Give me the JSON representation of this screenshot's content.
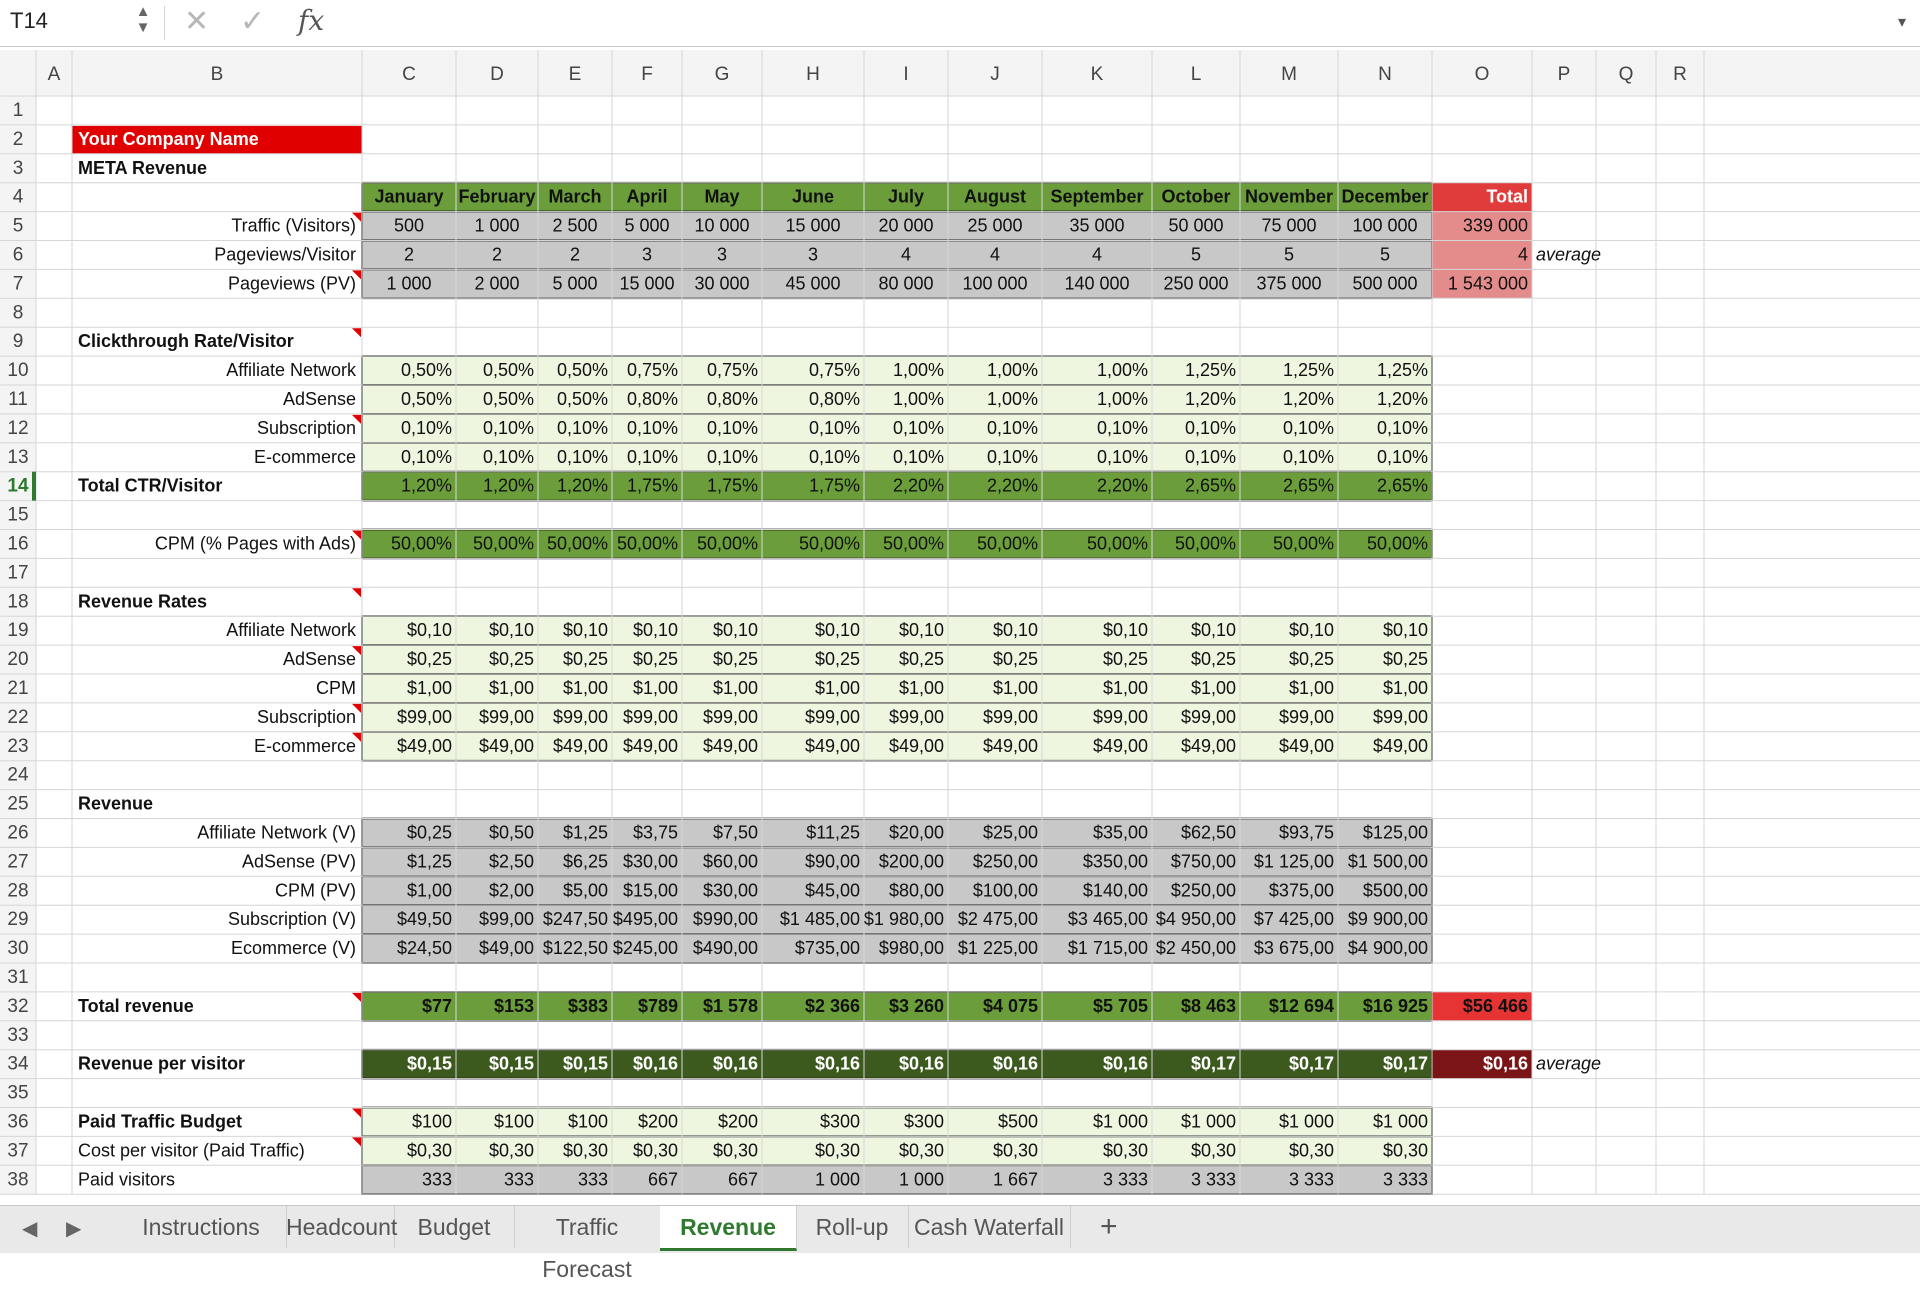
{
  "formula_bar": {
    "cell_ref": "T14",
    "stepper_up": "▲",
    "stepper_down": "▼",
    "cancel_glyph": "✕",
    "confirm_glyph": "✓",
    "fx_label": "fx",
    "formula": "",
    "expand_glyph": "▾"
  },
  "columns": [
    "A",
    "B",
    "C",
    "D",
    "E",
    "F",
    "G",
    "H",
    "I",
    "J",
    "K",
    "L",
    "M",
    "N",
    "O",
    "P",
    "Q",
    "R"
  ],
  "active_row": 14,
  "colors": {
    "green": "#6b9e3a",
    "dark_green": "#3d5a1e",
    "light_green": "#eef6e0",
    "gray": "#c8c8c8",
    "red_header": "#e03c3c",
    "pink_total": "#e48c8c",
    "red_total": "#e63434",
    "dark_red": "#7a1416",
    "company_red": "#e00000",
    "active_accent": "#2f7a2f"
  },
  "rows": [
    {
      "n": 1,
      "gap": true
    },
    {
      "n": 2,
      "b": "Your Company Name",
      "b_style": "company"
    },
    {
      "n": 3,
      "b": "META Revenue",
      "b_bold": true
    },
    {
      "n": 4,
      "fill": "green",
      "bold": true,
      "center": true,
      "vals": [
        "January",
        "February",
        "March",
        "April",
        "May",
        "June",
        "July",
        "August",
        "September",
        "October",
        "November",
        "December"
      ],
      "o": "Total",
      "o_fill": "red_header",
      "o_color": "#fff"
    },
    {
      "n": 5,
      "b": "Traffic (Visitors)",
      "b_right": true,
      "b_note": true,
      "fill": "gray",
      "center": true,
      "vals": [
        "500",
        "1 000",
        "2 500",
        "5 000",
        "10 000",
        "15 000",
        "20 000",
        "25 000",
        "35 000",
        "50 000",
        "75 000",
        "100 000"
      ],
      "o": "339 000",
      "o_fill": "pink_total"
    },
    {
      "n": 6,
      "b": "Pageviews/Visitor",
      "b_right": true,
      "fill": "gray",
      "center": true,
      "vals": [
        "2",
        "2",
        "2",
        "3",
        "3",
        "3",
        "4",
        "4",
        "4",
        "5",
        "5",
        "5"
      ],
      "o": "4",
      "o_fill": "pink_total",
      "p": "average"
    },
    {
      "n": 7,
      "b": "Pageviews (PV)",
      "b_right": true,
      "b_note": true,
      "fill": "gray",
      "center": true,
      "vals": [
        "1 000",
        "2 000",
        "5 000",
        "15 000",
        "30 000",
        "45 000",
        "80 000",
        "100 000",
        "140 000",
        "250 000",
        "375 000",
        "500 000"
      ],
      "o": "1 543 000",
      "o_fill": "pink_total"
    },
    {
      "n": 8,
      "gap": true
    },
    {
      "n": 9,
      "b": "Clickthrough Rate/Visitor",
      "b_bold": true,
      "b_note": true
    },
    {
      "n": 10,
      "b": "Affiliate Network",
      "b_right": true,
      "fill": "light_green",
      "vals": [
        "0,50%",
        "0,50%",
        "0,50%",
        "0,75%",
        "0,75%",
        "0,75%",
        "1,00%",
        "1,00%",
        "1,00%",
        "1,25%",
        "1,25%",
        "1,25%"
      ]
    },
    {
      "n": 11,
      "b": "AdSense",
      "b_right": true,
      "fill": "light_green",
      "vals": [
        "0,50%",
        "0,50%",
        "0,50%",
        "0,80%",
        "0,80%",
        "0,80%",
        "1,00%",
        "1,00%",
        "1,00%",
        "1,20%",
        "1,20%",
        "1,20%"
      ]
    },
    {
      "n": 12,
      "b": "Subscription",
      "b_right": true,
      "b_note": true,
      "fill": "light_green",
      "vals": [
        "0,10%",
        "0,10%",
        "0,10%",
        "0,10%",
        "0,10%",
        "0,10%",
        "0,10%",
        "0,10%",
        "0,10%",
        "0,10%",
        "0,10%",
        "0,10%"
      ]
    },
    {
      "n": 13,
      "b": "E-commerce",
      "b_right": true,
      "fill": "light_green",
      "vals": [
        "0,10%",
        "0,10%",
        "0,10%",
        "0,10%",
        "0,10%",
        "0,10%",
        "0,10%",
        "0,10%",
        "0,10%",
        "0,10%",
        "0,10%",
        "0,10%"
      ]
    },
    {
      "n": 14,
      "b": "Total CTR/Visitor",
      "b_bold": true,
      "fill": "green",
      "vals": [
        "1,20%",
        "1,20%",
        "1,20%",
        "1,75%",
        "1,75%",
        "1,75%",
        "2,20%",
        "2,20%",
        "2,20%",
        "2,65%",
        "2,65%",
        "2,65%"
      ]
    },
    {
      "n": 15,
      "gap": true
    },
    {
      "n": 16,
      "b": "CPM (% Pages with Ads)",
      "b_right": true,
      "b_note": true,
      "fill": "green",
      "vals": [
        "50,00%",
        "50,00%",
        "50,00%",
        "50,00%",
        "50,00%",
        "50,00%",
        "50,00%",
        "50,00%",
        "50,00%",
        "50,00%",
        "50,00%",
        "50,00%"
      ]
    },
    {
      "n": 17,
      "gap": true
    },
    {
      "n": 18,
      "b": "Revenue Rates",
      "b_bold": true,
      "b_note": true
    },
    {
      "n": 19,
      "b": "Affiliate Network",
      "b_right": true,
      "fill": "light_green",
      "vals": [
        "$0,10",
        "$0,10",
        "$0,10",
        "$0,10",
        "$0,10",
        "$0,10",
        "$0,10",
        "$0,10",
        "$0,10",
        "$0,10",
        "$0,10",
        "$0,10"
      ]
    },
    {
      "n": 20,
      "b": "AdSense",
      "b_right": true,
      "b_note": true,
      "fill": "light_green",
      "vals": [
        "$0,25",
        "$0,25",
        "$0,25",
        "$0,25",
        "$0,25",
        "$0,25",
        "$0,25",
        "$0,25",
        "$0,25",
        "$0,25",
        "$0,25",
        "$0,25"
      ]
    },
    {
      "n": 21,
      "b": "CPM",
      "b_right": true,
      "fill": "light_green",
      "vals": [
        "$1,00",
        "$1,00",
        "$1,00",
        "$1,00",
        "$1,00",
        "$1,00",
        "$1,00",
        "$1,00",
        "$1,00",
        "$1,00",
        "$1,00",
        "$1,00"
      ]
    },
    {
      "n": 22,
      "b": "Subscription",
      "b_right": true,
      "b_note": true,
      "fill": "light_green",
      "vals": [
        "$99,00",
        "$99,00",
        "$99,00",
        "$99,00",
        "$99,00",
        "$99,00",
        "$99,00",
        "$99,00",
        "$99,00",
        "$99,00",
        "$99,00",
        "$99,00"
      ]
    },
    {
      "n": 23,
      "b": "E-commerce",
      "b_right": true,
      "b_note": true,
      "fill": "light_green",
      "vals": [
        "$49,00",
        "$49,00",
        "$49,00",
        "$49,00",
        "$49,00",
        "$49,00",
        "$49,00",
        "$49,00",
        "$49,00",
        "$49,00",
        "$49,00",
        "$49,00"
      ]
    },
    {
      "n": 24,
      "gap": true
    },
    {
      "n": 25,
      "b": "Revenue",
      "b_bold": true
    },
    {
      "n": 26,
      "b": "Affiliate Network (V)",
      "b_right": true,
      "fill": "gray",
      "vals": [
        "$0,25",
        "$0,50",
        "$1,25",
        "$3,75",
        "$7,50",
        "$11,25",
        "$20,00",
        "$25,00",
        "$35,00",
        "$62,50",
        "$93,75",
        "$125,00"
      ]
    },
    {
      "n": 27,
      "b": "AdSense (PV)",
      "b_right": true,
      "fill": "gray",
      "vals": [
        "$1,25",
        "$2,50",
        "$6,25",
        "$30,00",
        "$60,00",
        "$90,00",
        "$200,00",
        "$250,00",
        "$350,00",
        "$750,00",
        "$1 125,00",
        "$1 500,00"
      ]
    },
    {
      "n": 28,
      "b": "CPM (PV)",
      "b_right": true,
      "fill": "gray",
      "vals": [
        "$1,00",
        "$2,00",
        "$5,00",
        "$15,00",
        "$30,00",
        "$45,00",
        "$80,00",
        "$100,00",
        "$140,00",
        "$250,00",
        "$375,00",
        "$500,00"
      ]
    },
    {
      "n": 29,
      "b": "Subscription (V)",
      "b_right": true,
      "fill": "gray",
      "vals": [
        "$49,50",
        "$99,00",
        "$247,50",
        "$495,00",
        "$990,00",
        "$1 485,00",
        "$1 980,00",
        "$2 475,00",
        "$3 465,00",
        "$4 950,00",
        "$7 425,00",
        "$9 900,00"
      ]
    },
    {
      "n": 30,
      "b": "Ecommerce (V)",
      "b_right": true,
      "fill": "gray",
      "vals": [
        "$24,50",
        "$49,00",
        "$122,50",
        "$245,00",
        "$490,00",
        "$735,00",
        "$980,00",
        "$1 225,00",
        "$1 715,00",
        "$2 450,00",
        "$3 675,00",
        "$4 900,00"
      ]
    },
    {
      "n": 31,
      "gap": true
    },
    {
      "n": 32,
      "b": "Total revenue",
      "b_bold": true,
      "b_note": true,
      "fill": "green",
      "bold": true,
      "vals": [
        "$77",
        "$153",
        "$383",
        "$789",
        "$1 578",
        "$2 366",
        "$3 260",
        "$4 075",
        "$5 705",
        "$8 463",
        "$12 694",
        "$16 925"
      ],
      "o": "$56 466",
      "o_fill": "red_total",
      "o_bold": true
    },
    {
      "n": 33,
      "gap": true
    },
    {
      "n": 34,
      "b": "Revenue per visitor",
      "b_bold": true,
      "fill": "dark_green",
      "bold": true,
      "color": "#fff",
      "vals": [
        "$0,15",
        "$0,15",
        "$0,15",
        "$0,16",
        "$0,16",
        "$0,16",
        "$0,16",
        "$0,16",
        "$0,16",
        "$0,17",
        "$0,17",
        "$0,17"
      ],
      "o": "$0,16",
      "o_fill": "dark_red",
      "o_color": "#fff",
      "o_bold": true,
      "p": "average"
    },
    {
      "n": 35,
      "gap": true
    },
    {
      "n": 36,
      "b": "Paid Traffic Budget",
      "b_bold": true,
      "b_note": true,
      "fill": "light_green",
      "vals": [
        "$100",
        "$100",
        "$100",
        "$200",
        "$200",
        "$300",
        "$300",
        "$500",
        "$1 000",
        "$1 000",
        "$1 000",
        "$1 000"
      ]
    },
    {
      "n": 37,
      "b": "Cost per visitor (Paid Traffic)",
      "b_note": true,
      "fill": "light_green",
      "vals": [
        "$0,30",
        "$0,30",
        "$0,30",
        "$0,30",
        "$0,30",
        "$0,30",
        "$0,30",
        "$0,30",
        "$0,30",
        "$0,30",
        "$0,30",
        "$0,30"
      ]
    },
    {
      "n": 38,
      "b": "Paid visitors",
      "fill": "gray",
      "vals": [
        "333",
        "333",
        "333",
        "667",
        "667",
        "1 000",
        "1 000",
        "1 667",
        "3 333",
        "3 333",
        "3 333",
        "3 333"
      ]
    }
  ],
  "sheet_tabs": {
    "prev_glyph": "◀",
    "next_glyph": "▶",
    "add_glyph": "+",
    "active_index": 4,
    "tabs": [
      "Instructions",
      "Headcount",
      "Budget",
      "Traffic Forecast",
      "Revenue",
      "Roll-up",
      "Cash Waterfall"
    ]
  }
}
